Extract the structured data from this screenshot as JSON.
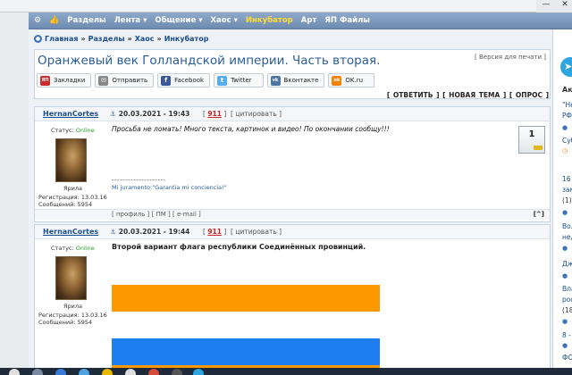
{
  "window_controls": [
    "—",
    "✕"
  ],
  "nav": {
    "items": [
      "Разделы",
      "Лента ▾",
      "Общение ▾",
      "Хаос ▾",
      "Инкубатор",
      "Арт",
      "ЯП Файлы"
    ],
    "highlight_index": 4
  },
  "breadcrumb": [
    "Главная",
    "Разделы",
    "Хаос",
    "Инкубатор"
  ],
  "breadcrumb_sep": "»",
  "topic": {
    "title": "Оранжевый век Голландской империи. Часть вторая.",
    "print_link": "[ Версия для печати ]"
  },
  "share": [
    {
      "label": "Закладки",
      "color": "#cc2a2a",
      "glyph": "ЯП"
    },
    {
      "label": "Отправить",
      "color": "#888888",
      "glyph": "✉"
    },
    {
      "label": "Facebook",
      "color": "#3b5998",
      "glyph": "f"
    },
    {
      "label": "Twitter",
      "color": "#55acee",
      "glyph": "t"
    },
    {
      "label": "Вконтакте",
      "color": "#4c75a3",
      "glyph": "vk"
    },
    {
      "label": "OK.ru",
      "color": "#f2840c",
      "glyph": "ok"
    }
  ],
  "topic_actions": "[ ОТВЕТИТЬ ] [ НОВАЯ ТЕМА ] [ ОПРОС ]",
  "posts": [
    {
      "author": "HernanCortes",
      "date": "20.03.2021 - 19:43",
      "number": "911",
      "quote": "[ цитировать ]",
      "status_label": "Статус:",
      "status": "Online",
      "rank": "Ярила",
      "registration": "Регистрация: 13.03.16",
      "messages": "Сообщений: 5954",
      "text": "Просьба не ломать! Много текста, картинок и видео! По окончании сообщу!!!",
      "sig_line": "--------------------",
      "signature": "Mi juramento:\"Garantia mi conciencia!\"",
      "rating": "1",
      "footer_links": "[ профиль ] [ ПМ ] [ e-mail ]",
      "up": "[^]"
    },
    {
      "author": "HernanCortes",
      "date": "20.03.2021 - 19:44",
      "number": "911",
      "quote": "[ цитировать ]",
      "status_label": "Статус:",
      "status": "Online",
      "rank": "Ярила",
      "registration": "Регистрация: 13.03.16",
      "messages": "Сообщений: 5954",
      "text": "Второй вариант флага республики Соединённых провинций.",
      "flag_colors": [
        "#ff9900",
        "#ffffff",
        "#1e7df0",
        "#ff9900"
      ]
    }
  ],
  "sidebar": {
    "telegram_glyph": "➤",
    "lines": [
      "\"Не",
      "РФ",
      "Суб",
      "16",
      "зам",
      "(1)",
      "Вол",
      "нед",
      "Дже",
      "Вла",
      "рос",
      "(18",
      "8 -",
      "ФОЕ"
    ],
    "header": "Акт"
  },
  "colors": {
    "nav_bg": "#7b97bd",
    "link": "#1a4d8c",
    "title": "#2a5d9a",
    "online": "#2a9d2a",
    "post_number": "#cc2222"
  }
}
